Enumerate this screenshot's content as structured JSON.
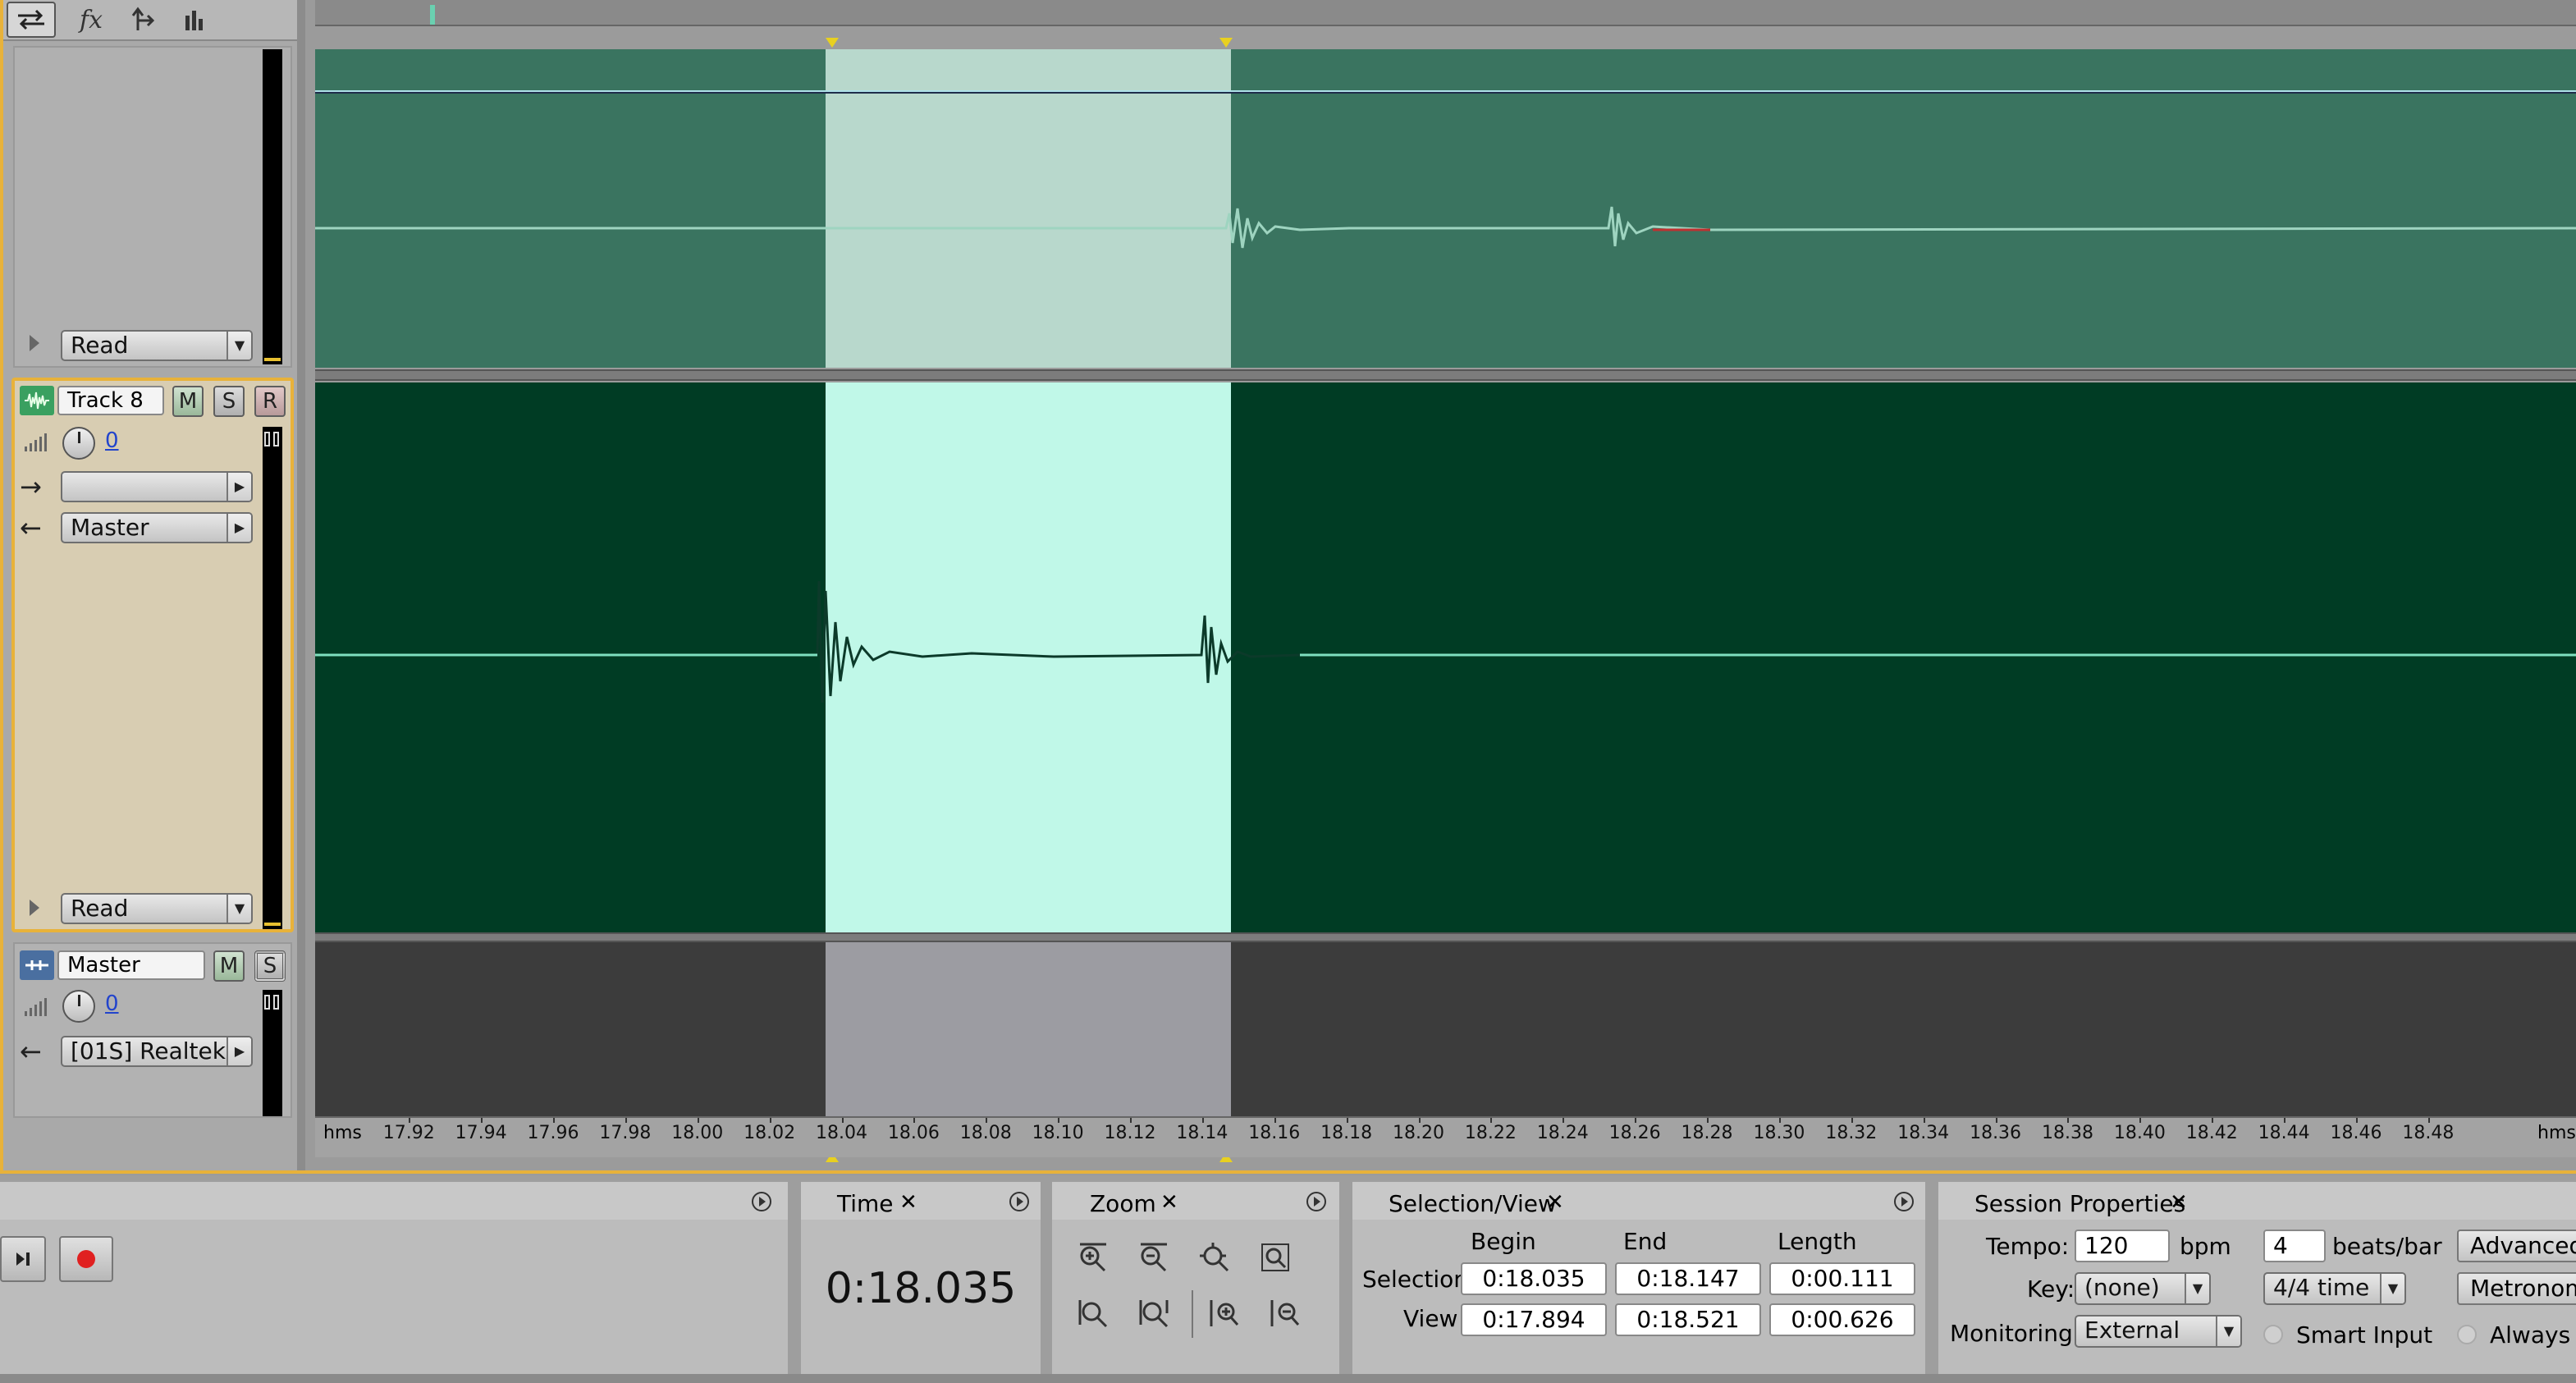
{
  "toolbar": {
    "icons": [
      "loop-icon",
      "fx-icon",
      "send-icon",
      "meter-icon"
    ]
  },
  "tracks": {
    "track7": {
      "automation_mode": "Read"
    },
    "track8": {
      "name": "Track 8",
      "mute": "M",
      "solo": "S",
      "record": "R",
      "volume": "0",
      "input": "",
      "output": "Master",
      "automation_mode": "Read"
    },
    "master": {
      "name": "Master",
      "mute": "M",
      "solo": "S",
      "volume": "0",
      "output": "[01S] Realtek"
    }
  },
  "timeline": {
    "unit_left": "hms",
    "unit_right": "hms",
    "ticks": [
      "17.92",
      "17.94",
      "17.96",
      "17.98",
      "18.00",
      "18.02",
      "18.04",
      "18.06",
      "18.08",
      "18.10",
      "18.12",
      "18.14",
      "18.16",
      "18.18",
      "18.20",
      "18.22",
      "18.24",
      "18.26",
      "18.28",
      "18.30",
      "18.32",
      "18.34",
      "18.36",
      "18.38",
      "18.40",
      "18.42",
      "18.44",
      "18.46",
      "18.48"
    ],
    "view_begin": 17.894,
    "view_end": 18.521,
    "selection_begin": 18.035,
    "selection_end": 18.147
  },
  "panels": {
    "time": {
      "title": "Time",
      "value": "0:18.035"
    },
    "zoom": {
      "title": "Zoom"
    },
    "selection_view": {
      "title": "Selection/View",
      "col_begin": "Begin",
      "col_end": "End",
      "col_length": "Length",
      "row_selection": "Selection",
      "row_view": "View",
      "selection_begin": "0:18.035",
      "selection_end": "0:18.147",
      "selection_length": "0:00.111",
      "view_begin": "0:17.894",
      "view_end": "0:18.521",
      "view_length": "0:00.626"
    },
    "session": {
      "title": "Session Properties",
      "tempo_label": "Tempo:",
      "tempo_value": "120",
      "tempo_unit": "bpm",
      "beats_value": "4",
      "beats_unit": "beats/bar",
      "advanced_label": "Advanced",
      "key_label": "Key:",
      "key_value": "(none)",
      "time_sig": "4/4 time",
      "metronome_label": "Metronom",
      "monitoring_label": "Monitoring:",
      "monitoring_value": "External",
      "smart_input_label": "Smart Input",
      "always_label": "Always I"
    }
  },
  "colors": {
    "track7_bg": "#3a7460",
    "track7_sel": "#b8d8cc",
    "track8_bg": "#003c24",
    "track8_sel": "#c0f8e8",
    "master_bg": "#3c3c3c",
    "master_sel": "#9c9ca2",
    "accent": "#e8b23a"
  }
}
